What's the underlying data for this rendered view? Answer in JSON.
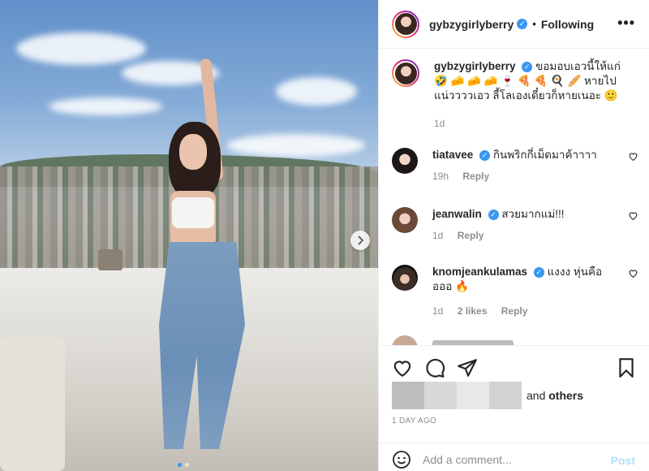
{
  "post": {
    "username": "gybzygirlyberry",
    "follow_status": "Following",
    "more_label": "•••",
    "caption": {
      "username": "gybzygirlyberry",
      "text": "ขอมอบเอวนี้ให้แก่ 🤣 🧀 🧀 🧀 🍷 🍕 🍕 🍳 🥖 หายไป แน่ววววเอว ลี้โลเองเดี๋ยวก็หายเนอะ 🙂",
      "time": "1d"
    },
    "comments": [
      {
        "username": "tiatavee",
        "text": "กินพริกกี่เม็ดมาค้าาาา",
        "time": "19h",
        "likes": "",
        "reply": "Reply"
      },
      {
        "username": "jeanwalin",
        "text": "สวยมากแม่!!!",
        "time": "1d",
        "likes": "",
        "reply": "Reply"
      },
      {
        "username": "knomjeankulamas",
        "text": "แงงง หุ่นคืออออ 🔥",
        "time": "1d",
        "likes": "2 likes",
        "reply": "Reply"
      }
    ],
    "likes_suffix": "and",
    "likes_others": "others",
    "timestamp": "1 DAY AGO",
    "add_comment_placeholder": "Add a comment...",
    "post_label": "Post"
  },
  "icons": {
    "verified": "verified-badge-icon",
    "heart": "heart-icon",
    "comment": "comment-icon",
    "share": "share-icon",
    "save": "bookmark-icon",
    "emoji": "emoji-icon",
    "next": "chevron-right-icon",
    "more": "more-options-icon"
  },
  "colors": {
    "accent_blue": "#3897f0",
    "post_disabled": "#b2dffc",
    "secondary_text": "#8e8e8e",
    "primary_text": "#262626",
    "border": "#efefef"
  }
}
